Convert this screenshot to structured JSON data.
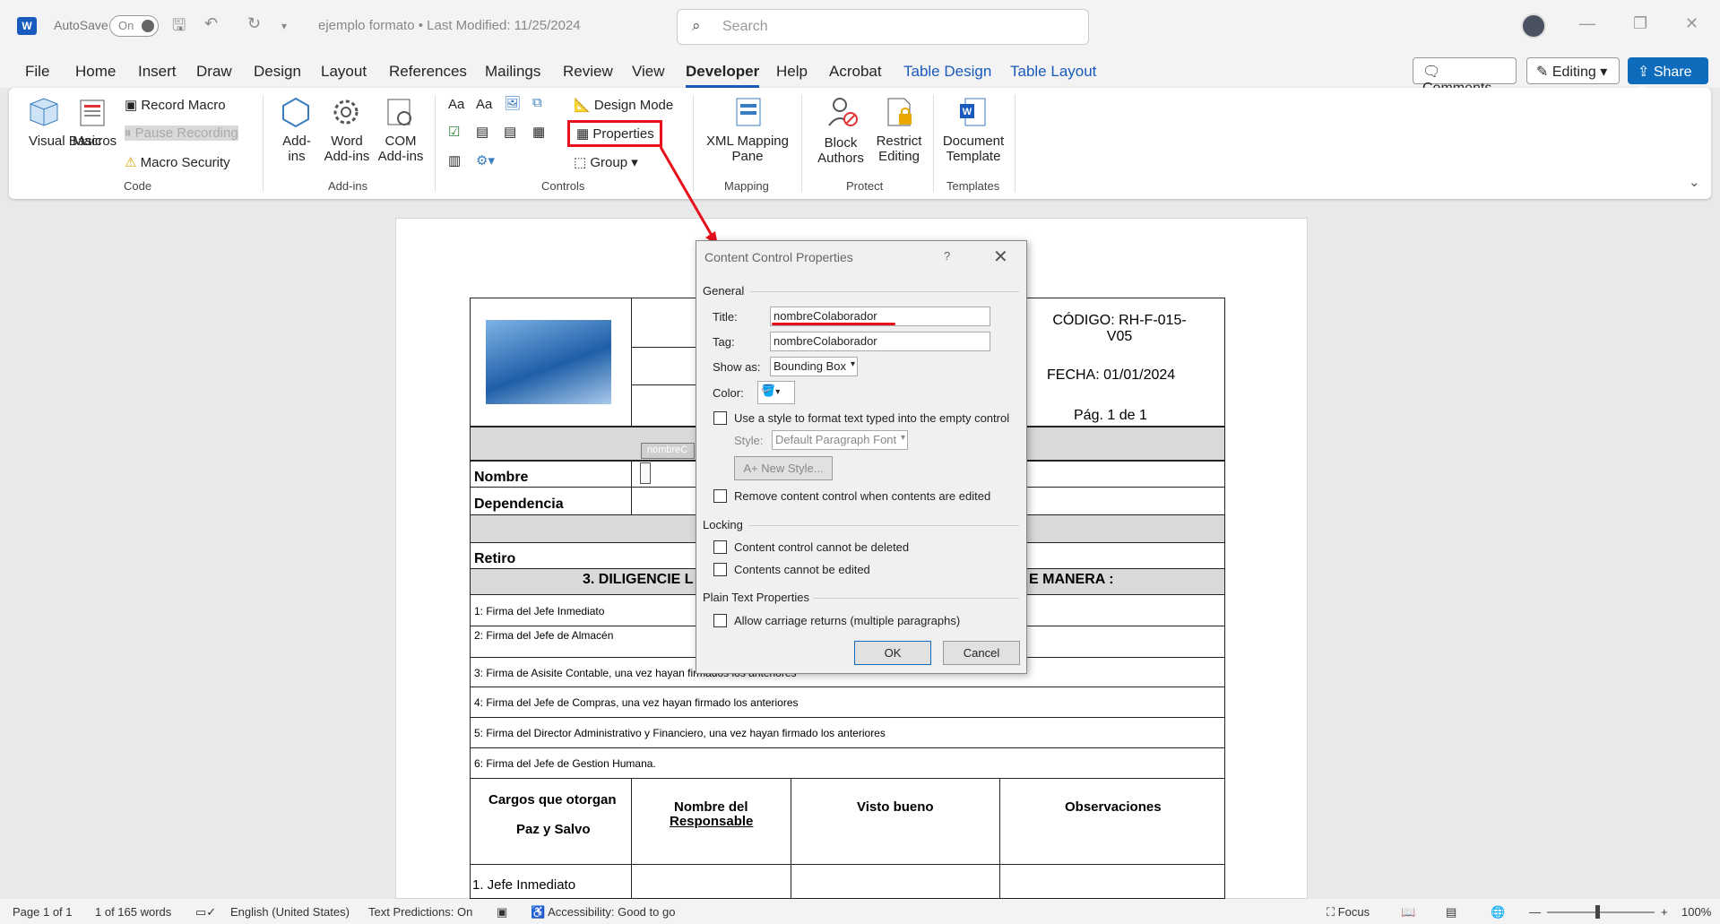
{
  "titlebar": {
    "autosave_label": "AutoSave",
    "autosave_state": "On",
    "doc_title": "ejemplo formato • Last Modified: 11/25/2024",
    "search_placeholder": "Search"
  },
  "menu": {
    "tabs": [
      "File",
      "Home",
      "Insert",
      "Draw",
      "Design",
      "Layout",
      "References",
      "Mailings",
      "Review",
      "View",
      "Developer",
      "Help",
      "Acrobat",
      "Table Design",
      "Table Layout"
    ],
    "active_tab": "Developer",
    "comments_label": "Comments",
    "editing_label": "Editing",
    "share_label": "Share"
  },
  "ribbon": {
    "code": {
      "visual_basic": "Visual Basic",
      "macros": "Macros",
      "record_macro": "Record Macro",
      "pause_recording": "Pause Recording",
      "macro_security": "Macro Security",
      "label": "Code"
    },
    "addins": {
      "add_ins": "Add-ins",
      "word_add_ins": "Word Add-ins",
      "com_add_ins": "COM Add-ins",
      "label": "Add-ins"
    },
    "controls": {
      "design_mode": "Design Mode",
      "properties": "Properties",
      "group": "Group",
      "label": "Controls"
    },
    "mapping": {
      "xml_mapping_pane": "XML Mapping Pane",
      "label": "Mapping"
    },
    "protect": {
      "block_authors": "Block Authors",
      "restrict_editing": "Restrict Editing",
      "label": "Protect"
    },
    "templates": {
      "document_template": "Document Template",
      "label": "Templates"
    }
  },
  "document": {
    "codigo": "CÓDIGO: RH-F-015-V05",
    "fecha": "FECHA: 01/01/2024",
    "pagina": "Pág. 1  de 1",
    "control_tag": "nombreC",
    "nombre": "Nombre",
    "dependencia": "Dependencia",
    "retiro": "Retiro",
    "section3": "3. DILIGENCIE L",
    "section3_end": "E MANERA :",
    "rows": [
      "1: Firma del Jefe Inmediato",
      "2: Firma del Jefe de Almacén",
      "3: Firma de Asisite Contable, una vez hayan firmados los anteriores",
      "4: Firma del Jefe de Compras, una vez hayan firmado los anteriores",
      "5: Firma del  Director  Administrativo y Financiero, una vez hayan firmado los anteriores",
      "6: Firma del Jefe de  Gestion Humana."
    ],
    "headers": {
      "cargos": "Cargos que otorgan",
      "paz": "Paz y Salvo",
      "nombre_del": "Nombre del",
      "responsable": "Responsable",
      "visto_bueno": "Visto bueno",
      "observaciones": "Observaciones"
    },
    "first_row": "1. Jefe Inmediato"
  },
  "dialog": {
    "title": "Content Control Properties",
    "help": "?",
    "general": "General",
    "title_label": "Title:",
    "title_value": "nombreColaborador",
    "tag_label": "Tag:",
    "tag_value": "nombreColaborador",
    "show_as_label": "Show as:",
    "show_as_value": "Bounding Box",
    "color_label": "Color:",
    "use_style": "Use a style to format text typed into the empty control",
    "style_label": "Style:",
    "style_value": "Default Paragraph Font",
    "new_style": "New Style...",
    "remove_control": "Remove content control when contents are edited",
    "locking": "Locking",
    "cannot_delete": "Content control cannot be deleted",
    "cannot_edit": "Contents cannot be edited",
    "plain_text": "Plain Text Properties",
    "carriage": "Allow carriage returns (multiple paragraphs)",
    "ok": "OK",
    "cancel": "Cancel"
  },
  "status": {
    "page": "Page 1 of 1",
    "words": "1 of 165 words",
    "language": "English (United States)",
    "predictions": "Text Predictions: On",
    "accessibility": "Accessibility: Good to go",
    "focus": "Focus",
    "zoom": "100%"
  },
  "colors": {
    "accent": "#185abd",
    "highlight": "#e8101b",
    "share": "#0f6cbd"
  }
}
